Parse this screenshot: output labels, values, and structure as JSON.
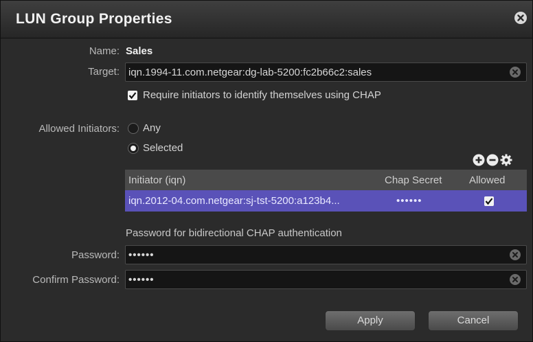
{
  "dialog": {
    "title": "LUN Group Properties",
    "close_icon": "close-circle-icon"
  },
  "name": {
    "label": "Name:",
    "value": "Sales"
  },
  "target": {
    "label": "Target:",
    "value": "iqn.1994-11.com.netgear:dg-lab-5200:fc2b66c2:sales"
  },
  "chap_required": {
    "label": "Require initiators to identify themselves using CHAP",
    "checked": true
  },
  "allowed_initiators": {
    "label": "Allowed Initiators:",
    "options": [
      "Any",
      "Selected"
    ],
    "selected": "Selected"
  },
  "toolbar": {
    "icons": [
      "add-icon",
      "remove-icon",
      "settings-gear-icon"
    ]
  },
  "initiator_table": {
    "columns": [
      "Initiator (iqn)",
      "Chap Secret",
      "Allowed"
    ],
    "rows": [
      {
        "initiator": "iqn.2012-04.com.netgear:sj-tst-5200:a123b4...",
        "chap_secret": "••••••",
        "allowed": true
      }
    ]
  },
  "bidirectional_note": "Password for bidirectional CHAP authentication",
  "password": {
    "label": "Password:",
    "value": "••••••"
  },
  "confirm_password": {
    "label": "Confirm Password:",
    "value": "••••••"
  },
  "buttons": {
    "apply": "Apply",
    "cancel": "Cancel"
  },
  "colors": {
    "selected_row": "#5a52b8",
    "background": "#2b2b2b",
    "titlebar": "#2f2f2f"
  }
}
